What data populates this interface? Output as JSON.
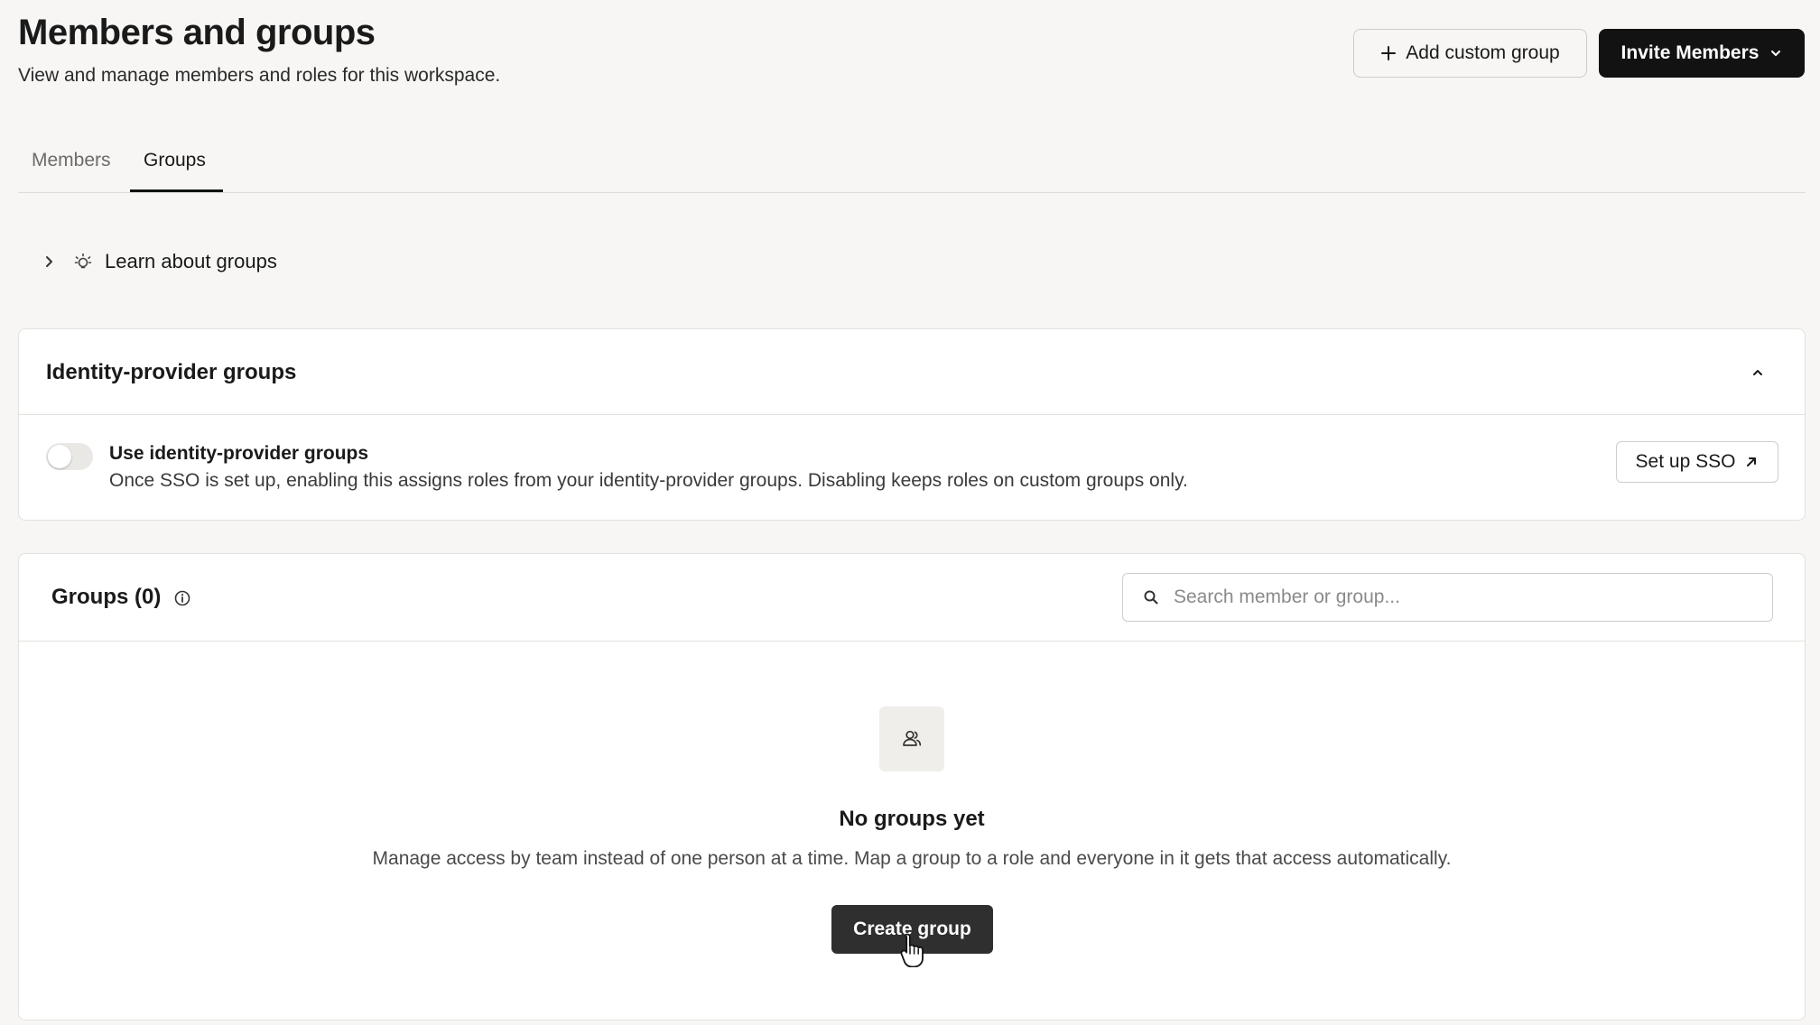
{
  "header": {
    "title": "Members and groups",
    "subtitle": "View and manage members and roles for this workspace.",
    "add_custom_group_label": "Add custom group",
    "invite_members_label": "Invite Members"
  },
  "tabs": [
    {
      "label": "Members",
      "active": false
    },
    {
      "label": "Groups",
      "active": true
    }
  ],
  "learn": {
    "label": "Learn about groups"
  },
  "idp": {
    "title": "Identity-provider groups",
    "toggle_enabled": false,
    "toggle_label": "Use identity-provider groups",
    "toggle_description": "Once SSO is set up, enabling this assigns roles from your identity-provider groups. Disabling keeps roles on custom groups only.",
    "sso_button_label": "Set up SSO"
  },
  "groups": {
    "title": "Groups (0)",
    "search_placeholder": "Search member or group...",
    "search_value": "",
    "empty_title": "No groups yet",
    "empty_description": "Manage access by team instead of one person at a time. Map a group to a role and everyone in it gets that access automatically.",
    "create_button_label": "Create group"
  },
  "colors": {
    "background": "#f7f6f4",
    "primary_button": "#121212",
    "create_button": "#2f2f2f",
    "card": "#ffffff",
    "border": "#e3e1dd"
  },
  "icons": [
    "plus-icon",
    "chevron-down-icon",
    "chevron-right-icon",
    "lightbulb-icon",
    "chevron-up-icon",
    "external-link-icon",
    "info-icon",
    "search-icon",
    "users-icon",
    "hand-cursor-icon"
  ]
}
